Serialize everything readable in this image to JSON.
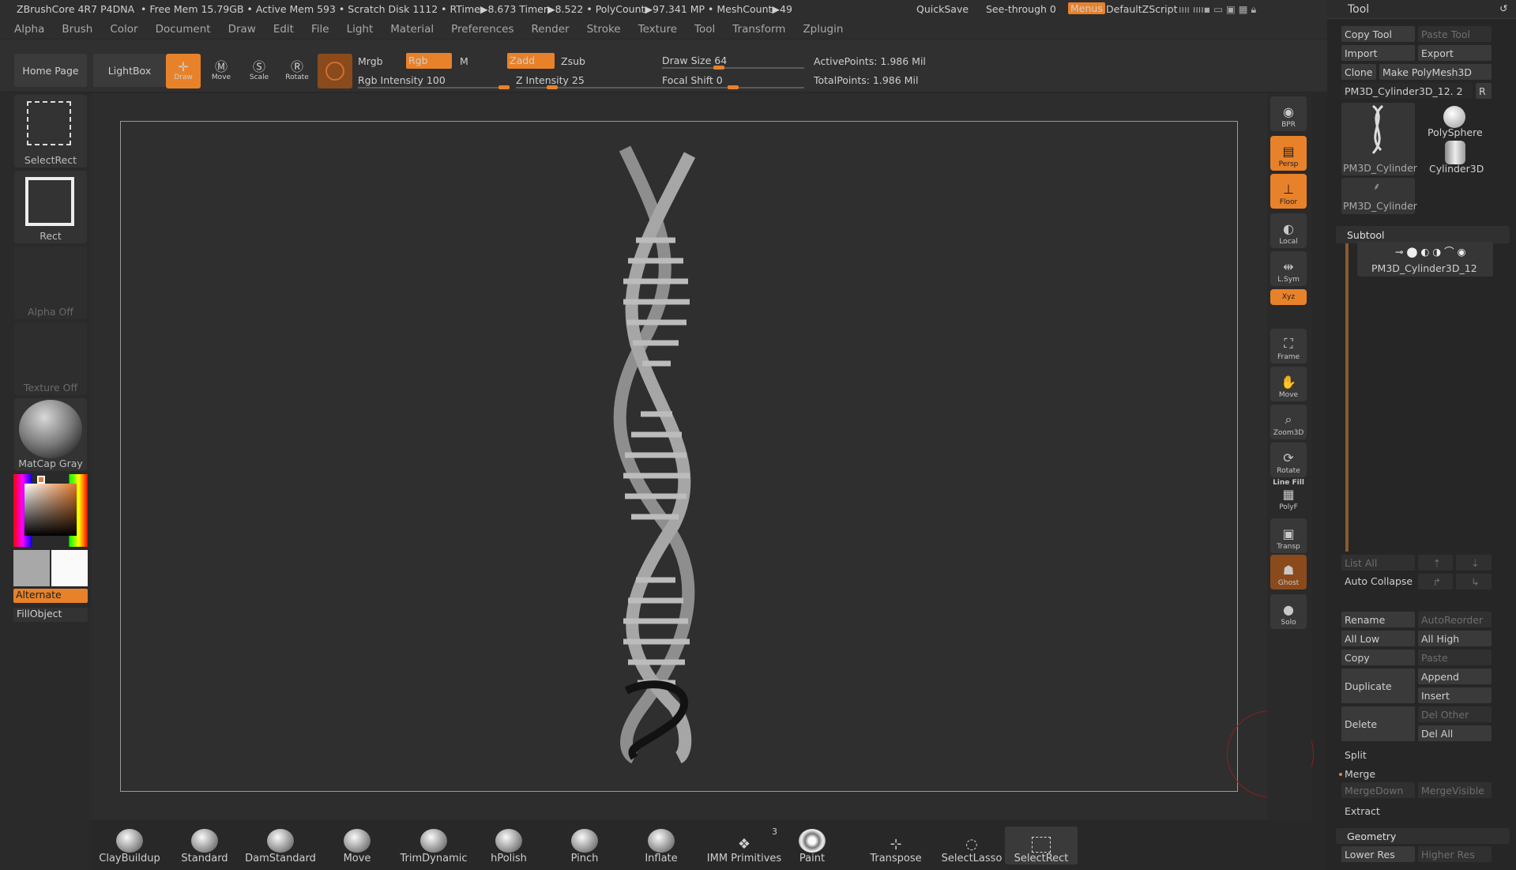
{
  "title_bar": {
    "app": "ZBrushCore 4R7 P4DNA",
    "stats": "• Free Mem 15.79GB • Active Mem 593 • Scratch Disk 1112 • RTime▶8.673 Timer▶8.522 • PolyCount▶97.341 MP • MeshCount▶49",
    "quicksave": "QuickSave",
    "seethrough": "See-through  0",
    "menus": "Menus",
    "script": "DefaultZScript"
  },
  "menu": [
    "Alpha",
    "Brush",
    "Color",
    "Document",
    "Draw",
    "Edit",
    "File",
    "Light",
    "Material",
    "Preferences",
    "Render",
    "Stroke",
    "Texture",
    "Tool",
    "Transform",
    "Zplugin"
  ],
  "toolbar": {
    "home": "Home Page",
    "lightbox": "LightBox",
    "draw": "Draw",
    "move": "Move",
    "scale": "Scale",
    "rotate": "Rotate",
    "mrgb": "Mrgb",
    "rgb": "Rgb",
    "m": "M",
    "zadd": "Zadd",
    "zsub": "Zsub",
    "rgb_intensity": "Rgb Intensity 100",
    "z_intensity": "Z Intensity 25",
    "draw_size": "Draw Size 64",
    "focal_shift": "Focal Shift 0",
    "active_points": "ActivePoints: 1.986 Mil",
    "total_points": "TotalPoints: 1.986 Mil",
    "rgb_intensity_value": 1.0,
    "z_intensity_value": 0.25,
    "draw_size_value": 0.4,
    "focal_shift_value": 0.5
  },
  "left": {
    "selectrect": "SelectRect",
    "rect": "Rect",
    "alpha_off": "Alpha Off",
    "texture_off": "Texture Off",
    "matcap": "MatCap Gray",
    "alternate": "Alternate",
    "fillobject": "FillObject"
  },
  "right_bar": [
    "BPR",
    "Persp",
    "Floor",
    "Local",
    "L.Sym",
    "Xyz",
    "Frame",
    "Move",
    "Zoom3D",
    "Rotate",
    "Line Fill",
    "PolyF",
    "Transp",
    "Ghost",
    "Solo"
  ],
  "brushes": [
    "ClayBuildup",
    "Standard",
    "DamStandard",
    "Move",
    "TrimDynamic",
    "hPolish",
    "Pinch",
    "Inflate",
    "IMM Primitives",
    "Paint",
    "Transpose",
    "SelectLasso",
    "SelectRect"
  ],
  "imm_count": "3",
  "tool": {
    "header": "Tool",
    "copy_tool": "Copy Tool",
    "paste_tool": "Paste Tool",
    "import": "Import",
    "export": "Export",
    "clone": "Clone",
    "make_polymesh": "Make PolyMesh3D",
    "current": "PM3D_Cylinder3D_12. 2",
    "r": "R",
    "thumb1": "PM3D_Cylinder",
    "thumb2": "PolySphere",
    "thumb3": "Cylinder3D",
    "thumb4": "PM3D_Cylinder",
    "subtool": "Subtool",
    "subtool_item": "PM3D_Cylinder3D_12",
    "list_all": "List All",
    "auto_collapse": "Auto Collapse",
    "rename": "Rename",
    "autoreorder": "AutoReorder",
    "all_low": "All Low",
    "all_high": "All High",
    "copy": "Copy",
    "paste": "Paste",
    "duplicate": "Duplicate",
    "append": "Append",
    "insert": "Insert",
    "delete": "Delete",
    "del_other": "Del Other",
    "del_all": "Del All",
    "split": "Split",
    "merge": "Merge",
    "mergedown": "MergeDown",
    "mergevisible": "MergeVisible",
    "extract": "Extract",
    "geometry": "Geometry",
    "lower_res": "Lower Res",
    "higher_res": "Higher Res"
  }
}
